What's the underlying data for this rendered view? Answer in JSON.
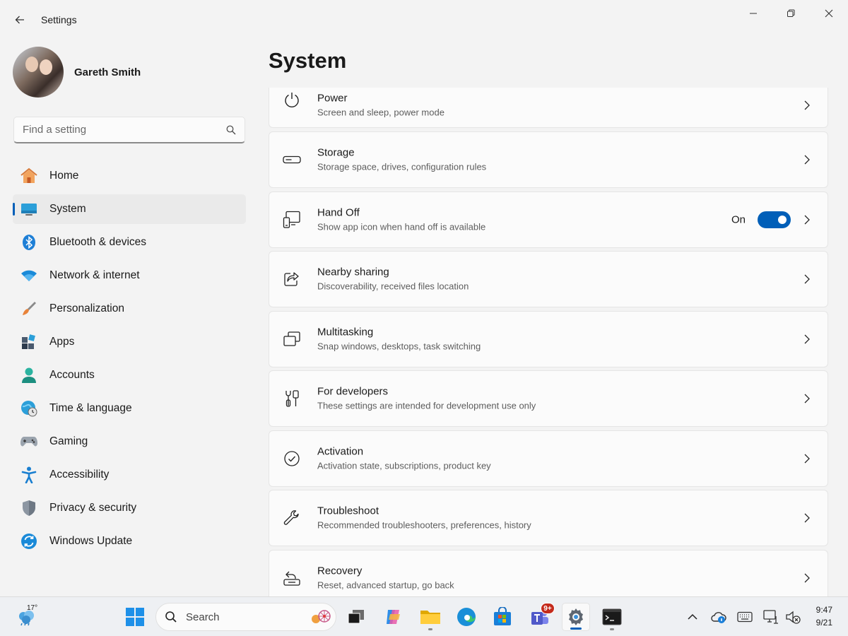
{
  "window": {
    "title": "Settings"
  },
  "profile": {
    "name": "Gareth Smith"
  },
  "search": {
    "placeholder": "Find a setting"
  },
  "sidebar": {
    "items": [
      {
        "label": "Home",
        "icon": "home-icon"
      },
      {
        "label": "System",
        "icon": "system-icon",
        "selected": true
      },
      {
        "label": "Bluetooth & devices",
        "icon": "bluetooth-icon"
      },
      {
        "label": "Network & internet",
        "icon": "wifi-icon"
      },
      {
        "label": "Personalization",
        "icon": "brush-icon"
      },
      {
        "label": "Apps",
        "icon": "apps-icon"
      },
      {
        "label": "Accounts",
        "icon": "person-icon"
      },
      {
        "label": "Time & language",
        "icon": "globe-clock-icon"
      },
      {
        "label": "Gaming",
        "icon": "gamepad-icon"
      },
      {
        "label": "Accessibility",
        "icon": "accessibility-icon"
      },
      {
        "label": "Privacy & security",
        "icon": "shield-icon"
      },
      {
        "label": "Windows Update",
        "icon": "update-icon"
      }
    ]
  },
  "main": {
    "title": "System",
    "cards": [
      {
        "title": "Power",
        "subtitle": "Screen and sleep, power mode",
        "icon": "power-icon"
      },
      {
        "title": "Storage",
        "subtitle": "Storage space, drives, configuration rules",
        "icon": "storage-icon"
      },
      {
        "title": "Hand Off",
        "subtitle": "Show app icon when hand off is available",
        "icon": "hand-off-icon",
        "toggle_label": "On",
        "toggle_on": true
      },
      {
        "title": "Nearby sharing",
        "subtitle": "Discoverability, received files location",
        "icon": "share-icon"
      },
      {
        "title": "Multitasking",
        "subtitle": "Snap windows, desktops, task switching",
        "icon": "multitasking-icon"
      },
      {
        "title": "For developers",
        "subtitle": "These settings are intended for development use only",
        "icon": "developer-tools-icon"
      },
      {
        "title": "Activation",
        "subtitle": "Activation state, subscriptions, product key",
        "icon": "check-circle-icon"
      },
      {
        "title": "Troubleshoot",
        "subtitle": "Recommended troubleshooters, preferences, history",
        "icon": "wrench-icon"
      },
      {
        "title": "Recovery",
        "subtitle": "Reset, advanced startup, go back",
        "icon": "recovery-icon"
      }
    ]
  },
  "taskbar": {
    "weather_temp": "17°",
    "search_label": "Search",
    "teams_badge": "9+",
    "time": "9:47",
    "date": "9/21"
  },
  "colors": {
    "accent": "#005fb8",
    "background": "#f3f3f3",
    "card": "#fbfbfb"
  }
}
